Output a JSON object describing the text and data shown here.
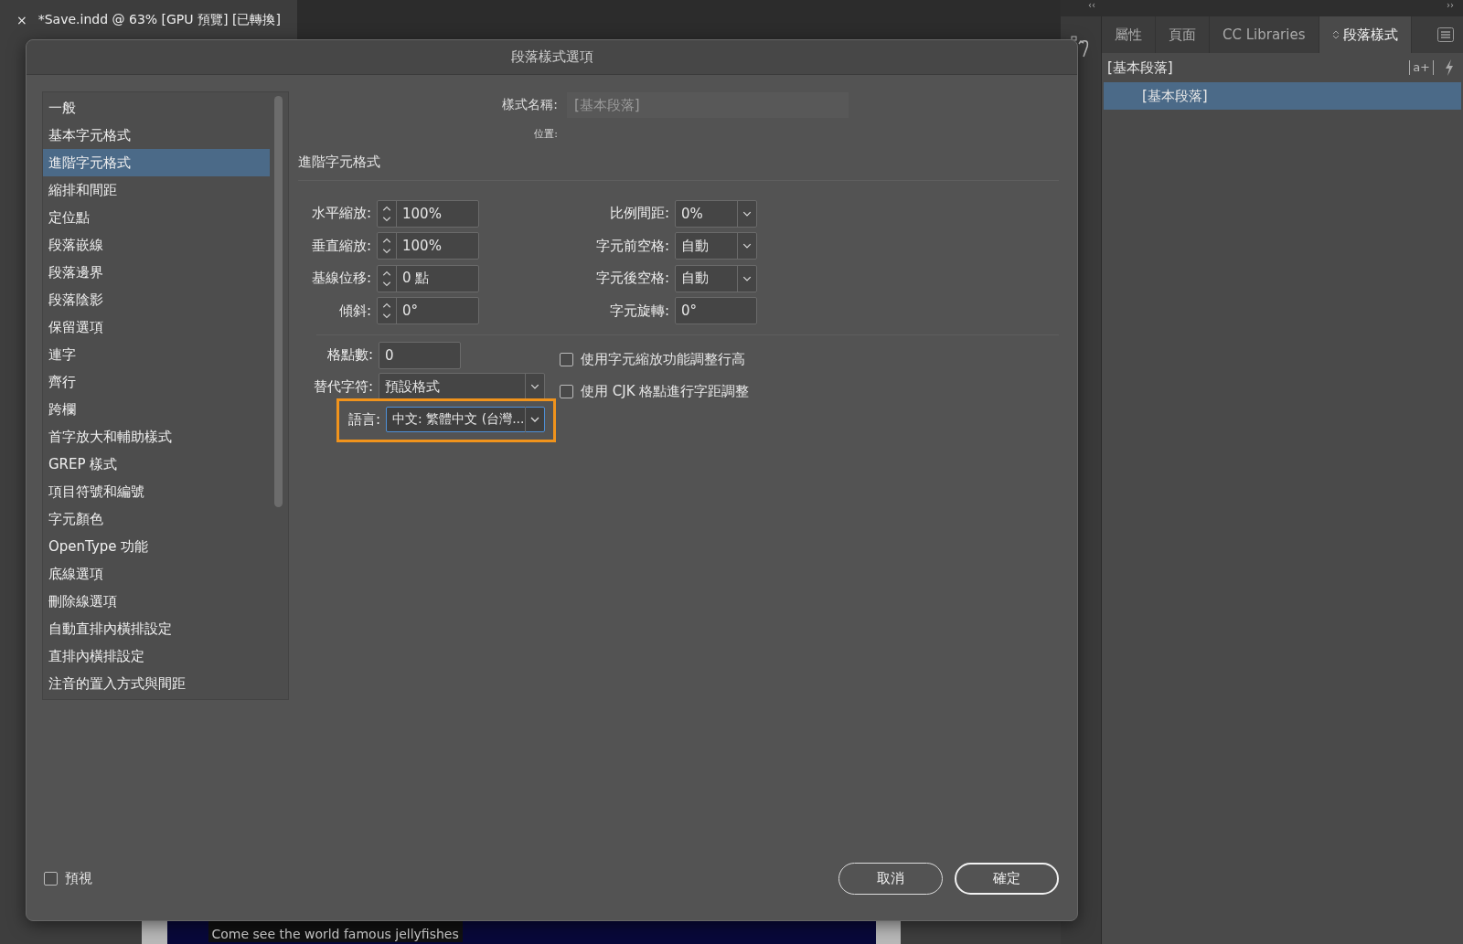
{
  "document_tab": {
    "close": "×",
    "title": "*Save.indd @ 63% [GPU 預覽] [已轉換]"
  },
  "canvas": {
    "caption": "Come see the world famous jellyfishes"
  },
  "dialog": {
    "title": "段落樣式選項",
    "categories": [
      {
        "label": "一般",
        "selected": false
      },
      {
        "label": "基本字元格式",
        "selected": false
      },
      {
        "label": "進階字元格式",
        "selected": true
      },
      {
        "label": "縮排和間距",
        "selected": false
      },
      {
        "label": "定位點",
        "selected": false
      },
      {
        "label": "段落嵌線",
        "selected": false
      },
      {
        "label": "段落邊界",
        "selected": false
      },
      {
        "label": "段落陰影",
        "selected": false
      },
      {
        "label": "保留選項",
        "selected": false
      },
      {
        "label": "連字",
        "selected": false
      },
      {
        "label": "齊行",
        "selected": false
      },
      {
        "label": "跨欄",
        "selected": false
      },
      {
        "label": "首字放大和輔助樣式",
        "selected": false
      },
      {
        "label": "GREP 樣式",
        "selected": false
      },
      {
        "label": "項目符號和編號",
        "selected": false
      },
      {
        "label": "字元顏色",
        "selected": false
      },
      {
        "label": "OpenType 功能",
        "selected": false
      },
      {
        "label": "底線選項",
        "selected": false
      },
      {
        "label": "刪除線選項",
        "selected": false
      },
      {
        "label": "自動直排內橫排設定",
        "selected": false
      },
      {
        "label": "直排內橫排設定",
        "selected": false
      },
      {
        "label": "注音的置入方式與間距",
        "selected": false
      }
    ],
    "style_name": {
      "label": "樣式名稱:",
      "value": "[基本段落]",
      "disabled": true
    },
    "location_label": "位置:",
    "section_title": "進階字元格式",
    "left_fields": [
      {
        "label": "水平縮放:",
        "value": "100%"
      },
      {
        "label": "垂直縮放:",
        "value": "100%"
      },
      {
        "label": "基線位移:",
        "value": "0 點"
      },
      {
        "label": "傾斜:",
        "value": "0°"
      }
    ],
    "right_fields": [
      {
        "label": "比例間距:",
        "value": "0%",
        "kind": "dropdown"
      },
      {
        "label": "字元前空格:",
        "value": "自動",
        "kind": "dropdown"
      },
      {
        "label": "字元後空格:",
        "value": "自動",
        "kind": "dropdown"
      },
      {
        "label": "字元旋轉:",
        "value": "0°",
        "kind": "text"
      }
    ],
    "grid_count": {
      "label": "格點數:",
      "value": "0"
    },
    "alternate_glyphs": {
      "label": "替代字符:",
      "value": "預設格式"
    },
    "language": {
      "label": "語言:",
      "value": "中文: 繁體中文 (台灣...",
      "highlighted": true
    },
    "checkboxes": [
      {
        "label": "使用字元縮放功能調整行高",
        "checked": false
      },
      {
        "label": "使用 CJK 格點進行字距調整",
        "checked": false
      }
    ],
    "preview": {
      "label": "預視",
      "checked": false
    },
    "buttons": [
      {
        "label": "取消",
        "kind": "secondary"
      },
      {
        "label": "確定",
        "kind": "primary"
      }
    ]
  },
  "panel": {
    "collapse_left": "‹‹",
    "collapse_right": "››",
    "tabs": [
      {
        "label": "屬性",
        "selected": false
      },
      {
        "label": "頁面",
        "selected": false
      },
      {
        "label": "CC Libraries",
        "selected": false
      },
      {
        "label": "段落樣式",
        "selected": true
      }
    ],
    "group": "[基本段落]",
    "new_style_glyph": "a+",
    "styles": [
      {
        "label": "[基本段落]",
        "selected": true
      }
    ]
  }
}
